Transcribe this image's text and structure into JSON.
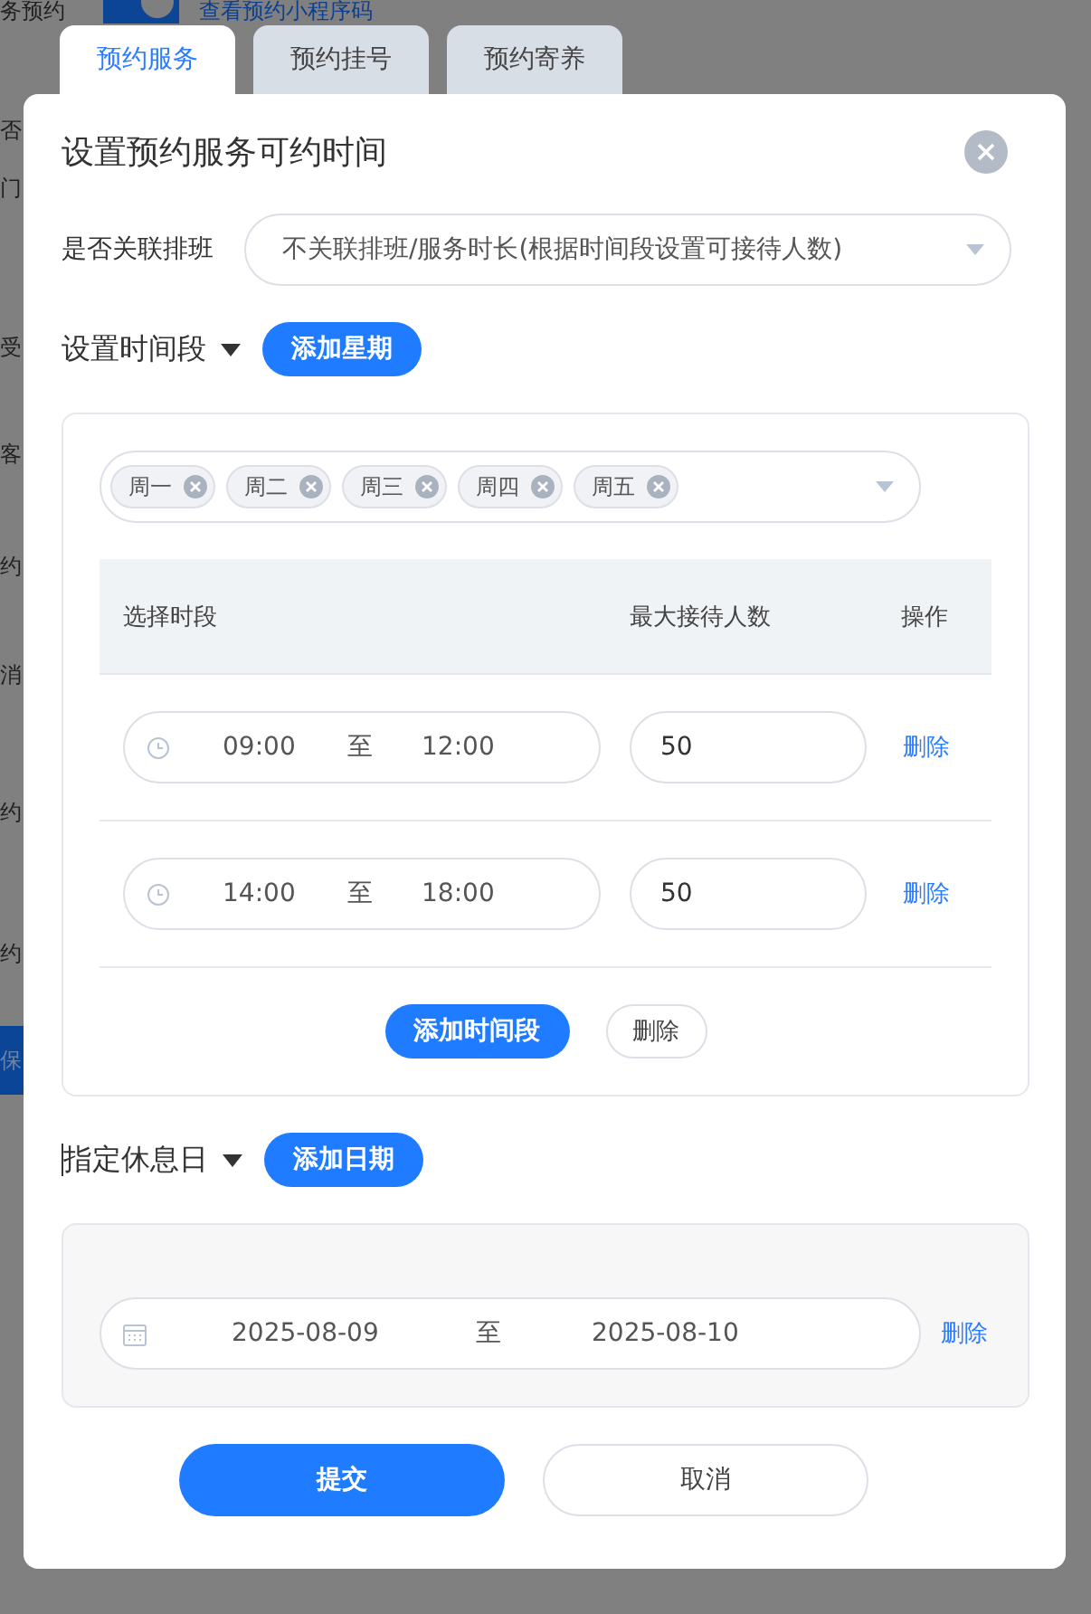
{
  "background": {
    "title": "务预约",
    "toggle": {
      "on": true
    },
    "link": "查看预约小程序码",
    "side_labels": [
      "否",
      "门",
      "受",
      "客",
      "约",
      "消",
      "约",
      "约"
    ],
    "side_button": "保"
  },
  "tabs": [
    {
      "label": "预约服务",
      "selected": true
    },
    {
      "label": "预约挂号",
      "selected": false
    },
    {
      "label": "预约寄养",
      "selected": false
    }
  ],
  "dialog": {
    "title": "设置预约服务可约时间",
    "link_schedule": {
      "label": "是否关联排班",
      "value": "不关联排班/服务时长(根据时间段设置可接待人数)"
    },
    "time_section": {
      "title": "设置时间段",
      "add_button": "添加星期",
      "weekdays": [
        "周一",
        "周二",
        "周三",
        "周四",
        "周五"
      ],
      "columns": [
        "选择时段",
        "最大接待人数",
        "操作"
      ],
      "rows": [
        {
          "start": "09:00",
          "separator": "至",
          "end": "12:00",
          "capacity": "50",
          "action": "删除"
        },
        {
          "start": "14:00",
          "separator": "至",
          "end": "18:00",
          "capacity": "50",
          "action": "删除"
        }
      ],
      "add_row_button": "添加时间段",
      "delete_button": "删除"
    },
    "rest_section": {
      "title": "指定休息日",
      "add_button": "添加日期",
      "ranges": [
        {
          "start": "2025-08-09",
          "separator": "至",
          "end": "2025-08-10",
          "action": "删除"
        }
      ]
    },
    "buttons": [
      {
        "label": "提交",
        "kind": "primary"
      },
      {
        "label": "取消",
        "kind": "secondary"
      }
    ]
  }
}
